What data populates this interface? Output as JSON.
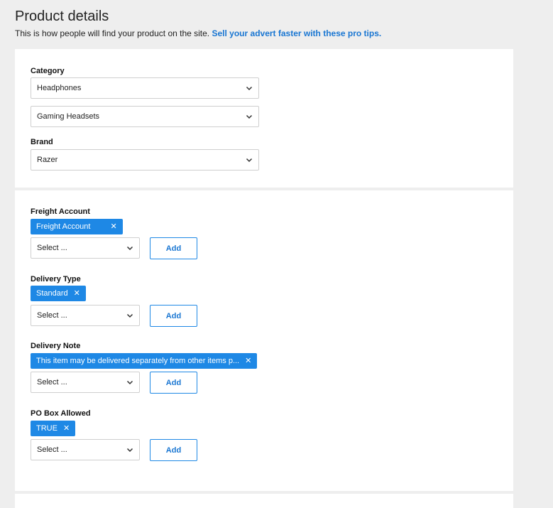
{
  "header": {
    "title": "Product details",
    "subtitle": "This is how people will find your product on the site.",
    "pro_tips_link": "Sell your advert faster with these pro tips."
  },
  "category_section": {
    "category_label": "Category",
    "category_value": "Headphones",
    "subcategory_value": "Gaming Headsets",
    "brand_label": "Brand",
    "brand_value": "Razer"
  },
  "attributes": [
    {
      "label": "Freight Account",
      "tag": "Freight Account",
      "select_placeholder": "Select ...",
      "add_label": "Add"
    },
    {
      "label": "Delivery Type",
      "tag": "Standard",
      "select_placeholder": "Select ...",
      "add_label": "Add"
    },
    {
      "label": "Delivery Note",
      "tag": "This item may be delivered separately from other items p...",
      "select_placeholder": "Select ...",
      "add_label": "Add"
    },
    {
      "label": "PO Box Allowed",
      "tag": "TRUE",
      "select_placeholder": "Select ...",
      "add_label": "Add"
    }
  ],
  "icons": {
    "dropdown": "chevron-down-icon",
    "remove_tag": "close-icon",
    "remove_tag_glyph": "✕"
  },
  "colors": {
    "accent": "#1e88e5",
    "link": "#1976d2",
    "background": "#eeeeee",
    "card": "#ffffff",
    "border": "#cfcfcf"
  }
}
